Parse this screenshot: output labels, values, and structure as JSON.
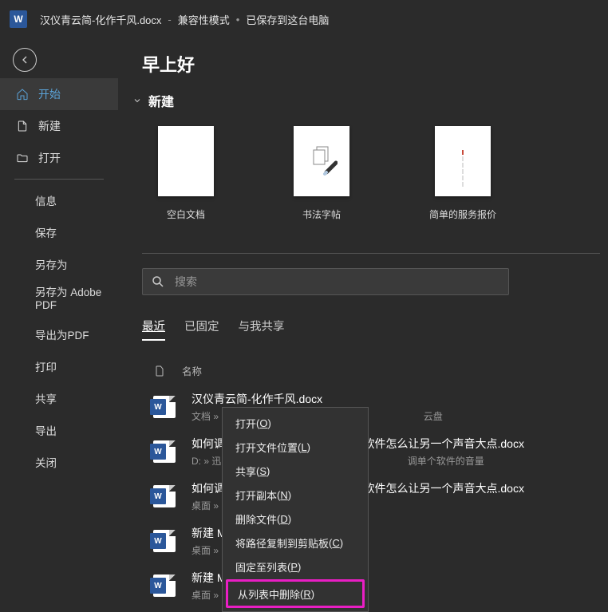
{
  "titlebar": {
    "filename": "汉仪青云简-化作千风.docx",
    "mode": "兼容性模式",
    "save_status": "已保存到这台电脑"
  },
  "sidebar": {
    "primary": [
      {
        "label": "开始",
        "icon": "home"
      },
      {
        "label": "新建",
        "icon": "new"
      },
      {
        "label": "打开",
        "icon": "open"
      }
    ],
    "secondary": [
      {
        "label": "信息"
      },
      {
        "label": "保存"
      },
      {
        "label": "另存为"
      },
      {
        "label": "另存为 Adobe PDF"
      },
      {
        "label": "导出为PDF"
      },
      {
        "label": "打印"
      },
      {
        "label": "共享"
      },
      {
        "label": "导出"
      },
      {
        "label": "关闭"
      }
    ]
  },
  "content": {
    "greeting": "早上好",
    "new_section": "新建",
    "templates": [
      {
        "label": "空白文档"
      },
      {
        "label": "书法字帖"
      },
      {
        "label": "简单的服务报价"
      }
    ],
    "search_placeholder": "搜索",
    "tabs": [
      {
        "label": "最近",
        "active": true
      },
      {
        "label": "已固定",
        "active": false
      },
      {
        "label": "与我共享",
        "active": false
      }
    ],
    "list_header": "名称",
    "files": [
      {
        "name": "汉仪青云简-化作千风.docx",
        "path": "文档 »"
      },
      {
        "name": "如何调",
        "path": "D: » 迅",
        "suffix_name": "个软件怎么让另一个声音大点.docx",
        "suffix_path": "调单个软件的音量"
      },
      {
        "name": "如何调",
        "path": "桌面 »",
        "suffix_name": "个软件怎么让另一个声音大点.docx"
      },
      {
        "name": "新建 M",
        "path": "桌面 »"
      },
      {
        "name": "新建 M",
        "path": "桌面 »"
      }
    ]
  },
  "context_menu": [
    {
      "label": "打开",
      "key": "O"
    },
    {
      "label": "打开文件位置",
      "key": "L"
    },
    {
      "label": "共享",
      "key": "S"
    },
    {
      "label": "打开副本",
      "key": "N"
    },
    {
      "label": "删除文件",
      "key": "D"
    },
    {
      "label": "将路径复制到剪贴板",
      "key": "C"
    },
    {
      "label": "固定至列表",
      "key": "P"
    },
    {
      "label": "从列表中删除",
      "key": "R",
      "highlighted": true
    }
  ]
}
